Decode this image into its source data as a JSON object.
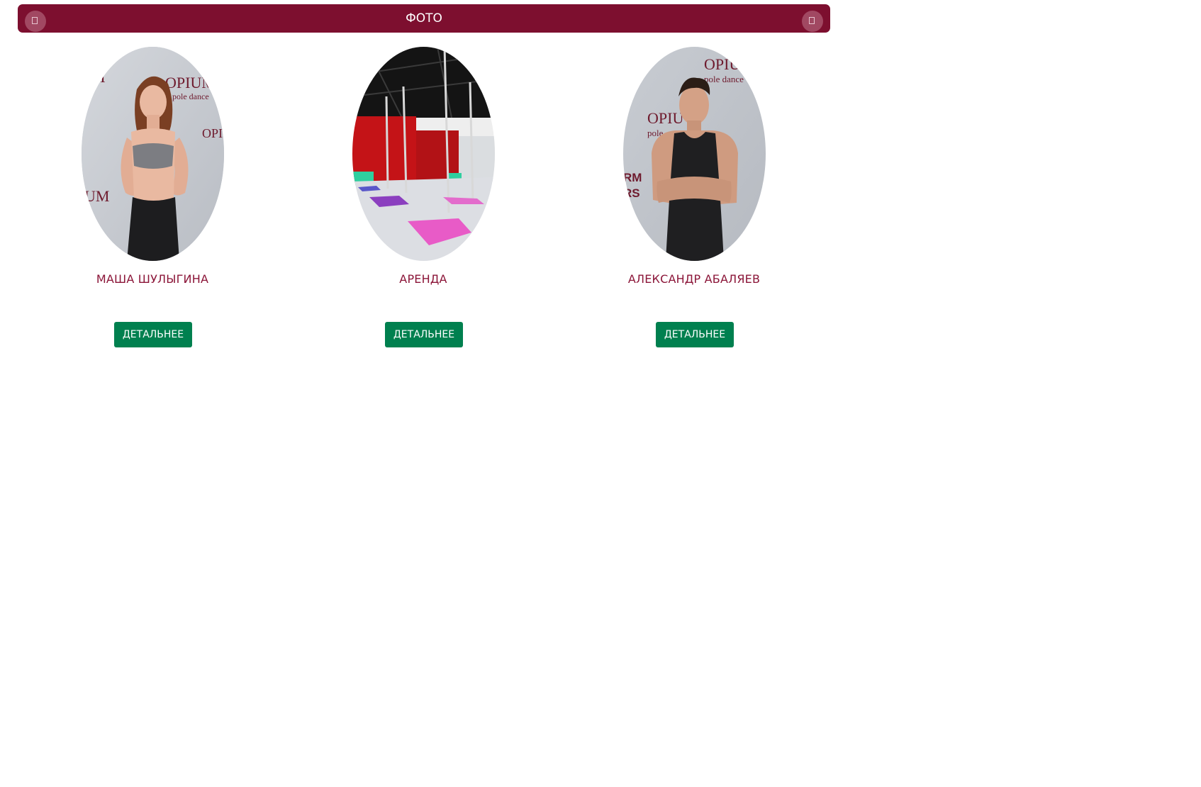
{
  "header": {
    "title": "ФОТО",
    "prev_icon": "chevron-left-icon",
    "next_icon": "chevron-right-icon",
    "background_color": "#7d0f2f"
  },
  "cards": [
    {
      "name": "МАША ШУЛЫГИНА",
      "button_label": "ДЕТАЛЬНЕЕ",
      "photo": "portrait-photo"
    },
    {
      "name": "АРЕНДА",
      "button_label": "ДЕТАЛЬНЕЕ",
      "photo": "studio-hall-photo"
    },
    {
      "name": "АЛЕКСАНДР АБАЛЯЕВ",
      "button_label": "ДЕТАЛЬНЕЕ",
      "photo": "portrait-photo"
    }
  ],
  "colors": {
    "name_text": "#8b1538",
    "button": "#00804f"
  },
  "logo_text": [
    "OPIUM",
    "pole dance"
  ]
}
